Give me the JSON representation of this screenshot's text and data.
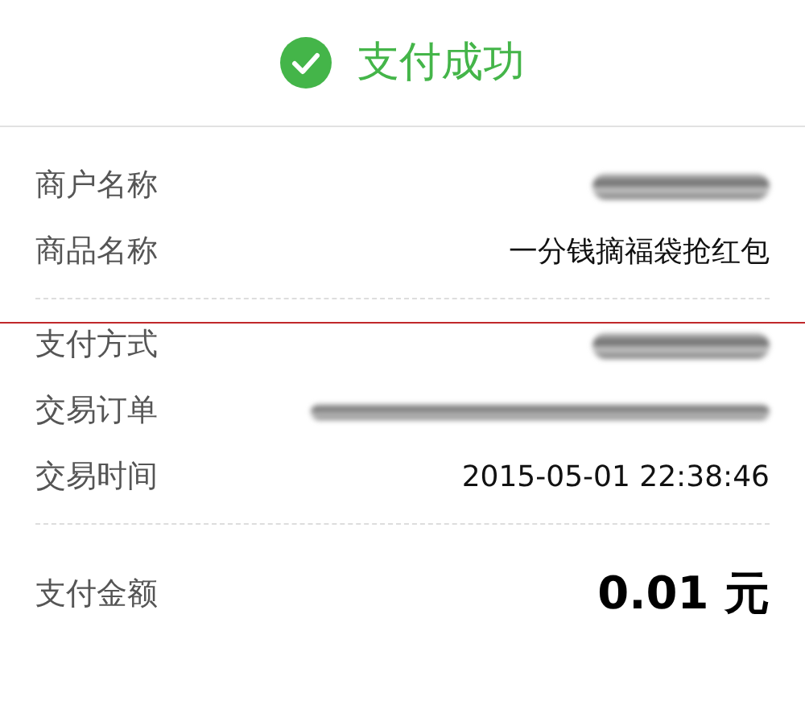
{
  "header": {
    "title": "支付成功"
  },
  "sections": [
    {
      "rows": [
        {
          "label": "商户名称",
          "kind": "redacted"
        },
        {
          "label": "商品名称",
          "kind": "text",
          "value": "一分钱摘福袋抢红包"
        }
      ]
    },
    {
      "rows": [
        {
          "label": "支付方式",
          "kind": "redacted"
        },
        {
          "label": "交易订单",
          "kind": "redacted-long"
        },
        {
          "label": "交易时间",
          "kind": "text",
          "value": "2015-05-01 22:38:46"
        }
      ]
    }
  ],
  "total": {
    "label": "支付金额",
    "value": "0.01 元"
  }
}
